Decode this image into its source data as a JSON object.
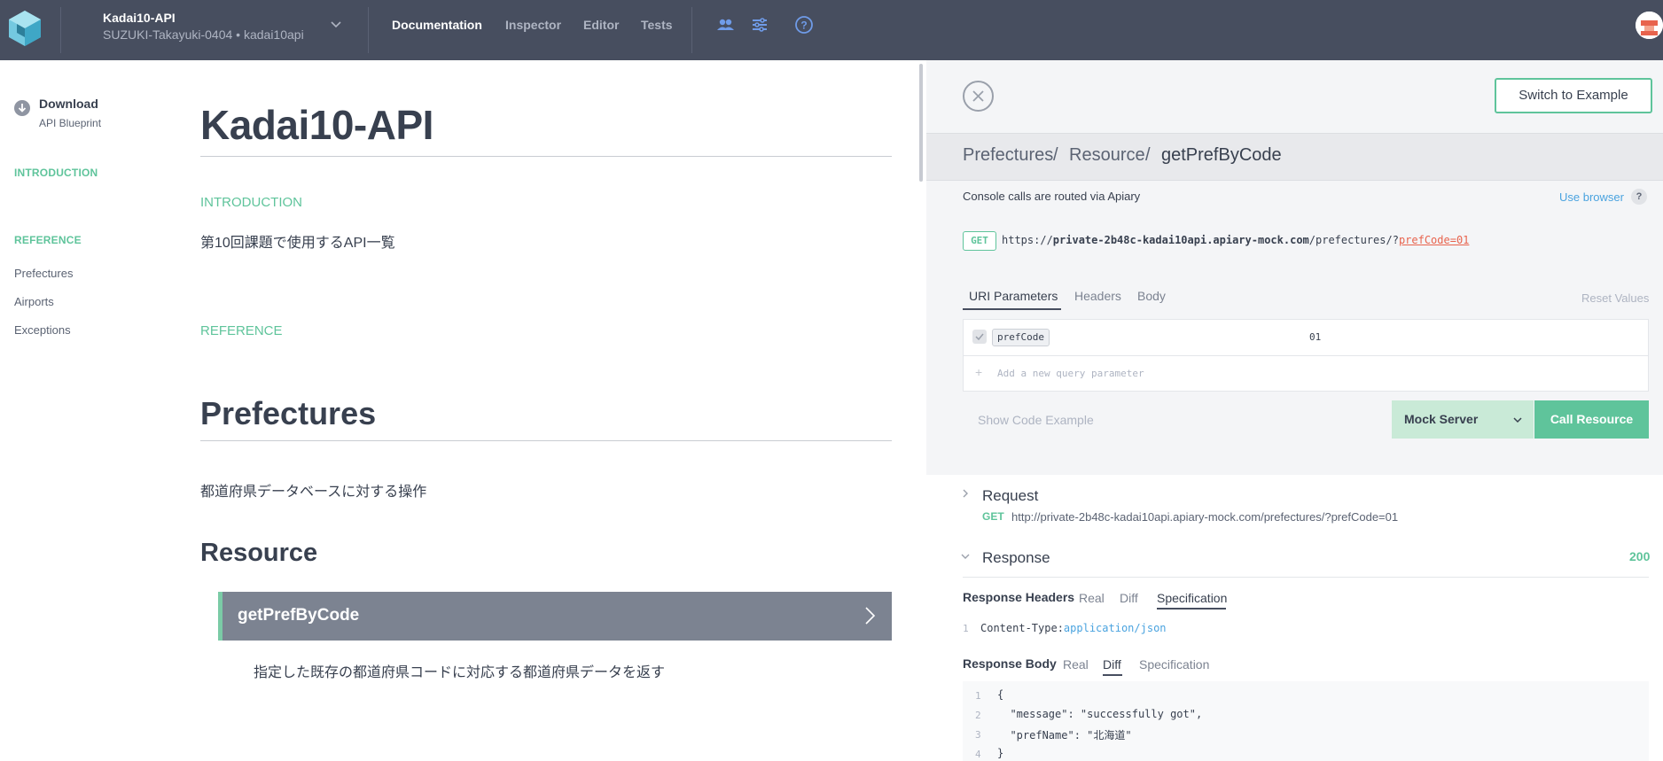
{
  "topbar": {
    "project_title": "Kadai10-API",
    "project_sub": "SUZUKI-Takayuki-0404 • kadai10api",
    "nav": [
      "Documentation",
      "Inspector",
      "Editor",
      "Tests"
    ],
    "active_nav": "Documentation"
  },
  "sidebar": {
    "download_title": "Download",
    "download_sub": "API Blueprint",
    "intro_heading": "INTRODUCTION",
    "ref_heading": "REFERENCE",
    "links": [
      "Prefectures",
      "Airports",
      "Exceptions"
    ]
  },
  "doc": {
    "title": "Kadai10-API",
    "intro_label": "INTRODUCTION",
    "intro_text": "第10回課題で使用するAPI一覧",
    "reference_label": "REFERENCE",
    "group_title": "Prefectures",
    "group_desc": "都道府県データベースに対する操作",
    "resource_title": "Resource",
    "action_name": "getPrefByCode",
    "action_desc": "指定した既存の都道府県コードに対応する都道府県データを返す"
  },
  "console": {
    "switch_label": "Switch to Example",
    "breadcrumb": [
      "Prefectures",
      "Resource",
      "getPrefByCode"
    ],
    "route_note": "Console calls are routed via Apiary",
    "use_browser": "Use browser",
    "help": "?",
    "method": "GET",
    "url_prefix": "https://",
    "url_host": "private-2b48c-kadai10api.apiary-mock.com",
    "url_path": "/prefectures/?",
    "url_query": "prefCode=01",
    "param_tabs": [
      "URI Parameters",
      "Headers",
      "Body"
    ],
    "reset": "Reset Values",
    "param_name": "prefCode",
    "param_value": "01",
    "add_param": "Add a new query parameter",
    "show_code": "Show Code Example",
    "server": "Mock Server",
    "call": "Call Resource"
  },
  "request": {
    "title": "Request",
    "method": "GET",
    "url": "http://private-2b48c-kadai10api.apiary-mock.com/prefectures/?prefCode=01"
  },
  "response": {
    "title": "Response",
    "status": "200",
    "headers_label": "Response Headers",
    "header_tabs": [
      "Real",
      "Diff",
      "Specification"
    ],
    "header_key": "Content-Type:",
    "header_val": "application/json",
    "body_label": "Response Body",
    "body_tabs": [
      "Real",
      "Diff",
      "Specification"
    ],
    "body_lines": [
      "{",
      "  \"message\": \"successfully got\",",
      "  \"prefName\": \"北海道\"",
      "}"
    ],
    "line_numbers": [
      "1",
      "2",
      "3",
      "4"
    ]
  },
  "colors": {
    "accent": "#5fc49b",
    "topbar": "#474e5f",
    "link": "#4aa3df",
    "error": "#e8634d"
  }
}
